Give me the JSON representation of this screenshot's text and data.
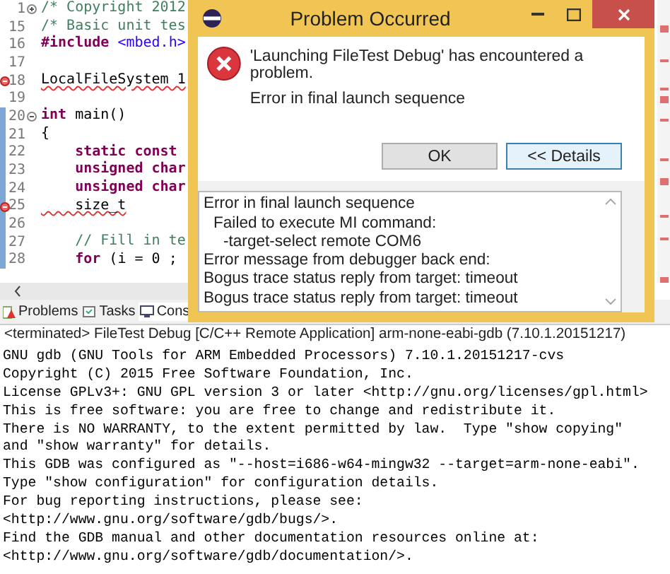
{
  "editor": {
    "lines": [
      {
        "number": "1",
        "collapsed": true,
        "error": false,
        "in_range": false,
        "segments": [
          {
            "text": "/* Copyright 2012",
            "kind": "comment"
          }
        ]
      },
      {
        "number": "15",
        "error": false,
        "in_range": false,
        "segments": [
          {
            "text": "/* Basic unit tes",
            "kind": "comment"
          }
        ]
      },
      {
        "number": "16",
        "error": false,
        "in_range": false,
        "segments": [
          {
            "text": "#include",
            "kind": "keyword"
          },
          {
            "text": " <mbed.h>",
            "kind": "string"
          }
        ]
      },
      {
        "number": "17",
        "error": false,
        "in_range": false
      },
      {
        "number": "18",
        "error": true,
        "in_range": false,
        "segments": [
          {
            "text": "LocalFileSystem 1",
            "kind": "plain"
          }
        ]
      },
      {
        "number": "19",
        "error": false,
        "in_range": false
      },
      {
        "number": "20",
        "collapsed": false,
        "error": false,
        "in_range": true,
        "segments": [
          {
            "text": "int",
            "kind": "keyword"
          },
          {
            "text": " main()",
            "kind": "plain"
          }
        ]
      },
      {
        "number": "21",
        "error": false,
        "in_range": true,
        "segments": [
          {
            "text": "{",
            "kind": "plain"
          }
        ]
      },
      {
        "number": "22",
        "error": false,
        "in_range": true,
        "segments": [
          {
            "text": "    static const",
            "kind": "keyword"
          }
        ]
      },
      {
        "number": "23",
        "error": false,
        "in_range": true,
        "segments": [
          {
            "text": "    unsigned char",
            "kind": "keyword"
          }
        ]
      },
      {
        "number": "24",
        "error": false,
        "in_range": true,
        "segments": [
          {
            "text": "    unsigned char",
            "kind": "keyword"
          }
        ]
      },
      {
        "number": "25",
        "error": true,
        "in_range": true,
        "segments": [
          {
            "text": "    size_t",
            "kind": "plain"
          }
        ]
      },
      {
        "number": "26",
        "error": false,
        "in_range": true
      },
      {
        "number": "27",
        "error": false,
        "in_range": true,
        "segments": [
          {
            "text": "    // Fill in te",
            "kind": "comment"
          }
        ]
      },
      {
        "number": "28",
        "error": false,
        "in_range": true,
        "segments": [
          {
            "text": "    for",
            "kind": "keyword"
          },
          {
            "text": " (i = 0 ;",
            "kind": "plain"
          }
        ]
      }
    ]
  },
  "dialog": {
    "title": "Problem Occurred",
    "message": "'Launching FileTest Debug' has encountered a problem.",
    "reason": "Error in final launch sequence",
    "buttons": [
      {
        "label": "OK",
        "selected": false
      },
      {
        "label": "<< Details",
        "selected": true
      }
    ],
    "details": [
      {
        "text": "Error in final launch sequence",
        "children": [
          {
            "text": "Failed to execute MI command:",
            "children": [
              {
                "text": "-target-select remote COM6"
              }
            ]
          }
        ]
      },
      {
        "text": "Error message from debugger back end:"
      },
      {
        "text": "Bogus trace status reply from target: timeout"
      },
      {
        "text": "Bogus trace status reply from target: timeout"
      }
    ]
  },
  "tabs": [
    {
      "label": "Problems",
      "kind": "problems",
      "selected": false
    },
    {
      "label": "Tasks",
      "kind": "tasks",
      "selected": false
    },
    {
      "label": "Cons",
      "kind": "console",
      "selected": true
    }
  ],
  "console": {
    "header": "<terminated> FileTest Debug [C/C++ Remote Application] arm-none-eabi-gdb (7.10.1.20151217)",
    "lines": [
      "GNU gdb (GNU Tools for ARM Embedded Processors) 7.10.1.20151217-cvs",
      "Copyright (C) 2015 Free Software Foundation, Inc.",
      "License GPLv3+: GNU GPL version 3 or later <http://gnu.org/licenses/gpl.html>",
      "This is free software: you are free to change and redistribute it.",
      "There is NO WARRANTY, to the extent permitted by law.  Type \"show copying\"",
      "and \"show warranty\" for details.",
      "This GDB was configured as \"--host=i686-w64-mingw32 --target=arm-none-eabi\".",
      "Type \"show configuration\" for configuration details.",
      "For bug reporting instructions, please see:",
      "<http://www.gnu.org/software/gdb/bugs/>.",
      "Find the GDB manual and other documentation resources online at:",
      "<http://www.gnu.org/software/gdb/documentation/>."
    ]
  }
}
